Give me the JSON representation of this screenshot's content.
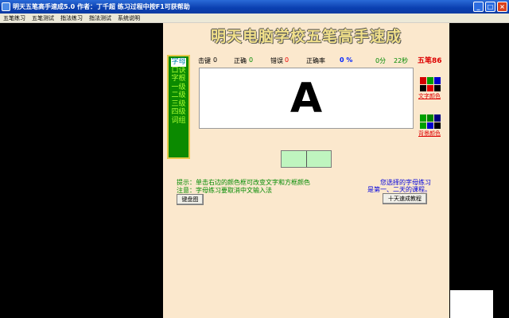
{
  "window": {
    "title": "明天五笔高手速成5.0     作者：丁千超     练习过程中按F1可获帮助",
    "minimize": "_",
    "maximize": "□",
    "close": "×"
  },
  "menu": [
    "五笔练习",
    "五笔测试",
    "指法练习",
    "指法测试",
    "系统说明"
  ],
  "banner": "明天电脑学校五笔高手速成",
  "modes": {
    "active": "字母",
    "items": [
      "口诀",
      "字根",
      "一级",
      "二级",
      "三级",
      "四级",
      "词组"
    ]
  },
  "stats": {
    "keystrokes_label": "击键",
    "keystrokes": "0",
    "correct_label": "正确",
    "correct": "0",
    "errors_label": "错误",
    "errors": "0",
    "accuracy_label": "正确率",
    "accuracy": "0 %",
    "minutes": "0分",
    "seconds": "22秒"
  },
  "target_char": "A",
  "wubi_version": "五笔86",
  "text_color_label": "文字颜色",
  "bg_color_label": "背景颜色",
  "text_palette": [
    "#d40000",
    "#00a000",
    "#0000cc",
    "#000000",
    "#e00000",
    "#000000"
  ],
  "bg_palette": [
    "#00a000",
    "#008800",
    "#000080",
    "#00a000",
    "#0000cc",
    "#000000"
  ],
  "hint_line1": "提示：单击右边的颜色框可改变文字和方框颜色",
  "hint_line2": "注意：字母练习要取消中文输入法",
  "prompt_line1": "您选择的字母练习",
  "prompt_line2": "是第一、二天的课程。",
  "keyboard_button": "键盘图",
  "tutorial_button": "十天速成教程"
}
